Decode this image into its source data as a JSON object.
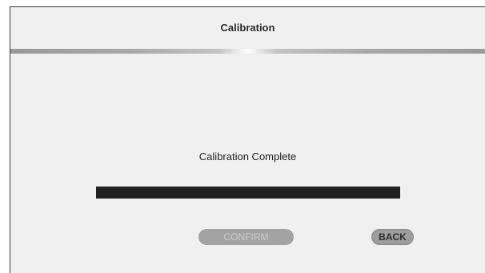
{
  "header": {
    "title": "Calibration"
  },
  "main": {
    "status_text": "Calibration Complete",
    "progress": 1.0
  },
  "buttons": {
    "confirm_label": "CONFIRM",
    "back_label": "BACK"
  },
  "colors": {
    "background": "#f0f0f0",
    "progress_fill": "#222222",
    "button_gray": "#a3a3a3"
  }
}
